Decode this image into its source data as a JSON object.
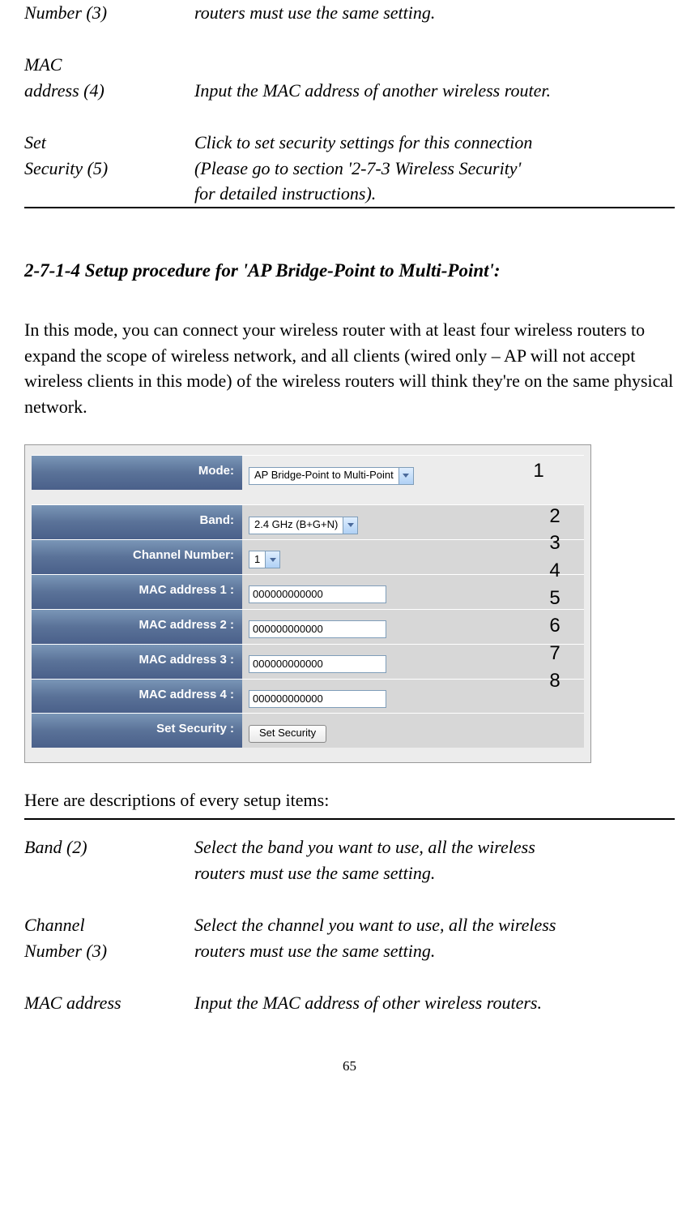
{
  "top_table": {
    "row1": {
      "label": "Number (3)",
      "desc": "routers must use the same setting."
    },
    "row2": {
      "label1": "MAC",
      "label2": "address (4)",
      "desc": "Input the MAC address of another wireless router."
    },
    "row3": {
      "label1": "Set",
      "label2": "Security (5)",
      "desc1": "Click to set security settings for this connection",
      "desc2": "(Please go to section '2-7-3 Wireless Security'",
      "desc3": "for detailed instructions)."
    }
  },
  "section_heading": "2-7-1-4 Setup procedure for 'AP Bridge-Point to Multi-Point':",
  "intro_paragraph": "In this mode, you can connect your wireless router with at least four wireless routers to expand the scope of wireless network, and all clients (wired only – AP will not accept wireless clients in this mode) of the wireless routers will think they're on the same physical network.",
  "form": {
    "mode_label": "Mode:",
    "mode_value": "AP Bridge-Point to Multi-Point",
    "band_label": "Band:",
    "band_value": "2.4 GHz (B+G+N)",
    "channel_label": "Channel Number:",
    "channel_value": "1",
    "mac1_label": "MAC address 1 :",
    "mac1_value": "000000000000",
    "mac2_label": "MAC address 2 :",
    "mac2_value": "000000000000",
    "mac3_label": "MAC address 3 :",
    "mac3_value": "000000000000",
    "mac4_label": "MAC address 4 :",
    "mac4_value": "000000000000",
    "security_label": "Set Security :",
    "security_button": "Set Security"
  },
  "annotations": {
    "a1": "1",
    "a2": "2",
    "a3": "3",
    "a4": "4",
    "a5": "5",
    "a6": "6",
    "a7": "7",
    "a8": "8"
  },
  "desc_intro": "Here are descriptions of every setup items:",
  "bottom_table": {
    "row1": {
      "label": "Band (2)",
      "desc1": "Select the band you want to use, all the wireless",
      "desc2": "routers must use the same setting."
    },
    "row2": {
      "label1": "Channel",
      "label2": "Number (3)",
      "desc1": "Select the channel you want to use, all the wireless",
      "desc2": "routers must use the same setting."
    },
    "row3": {
      "label": "MAC address",
      "desc": "Input the MAC address of other wireless routers."
    }
  },
  "page_number": "65"
}
